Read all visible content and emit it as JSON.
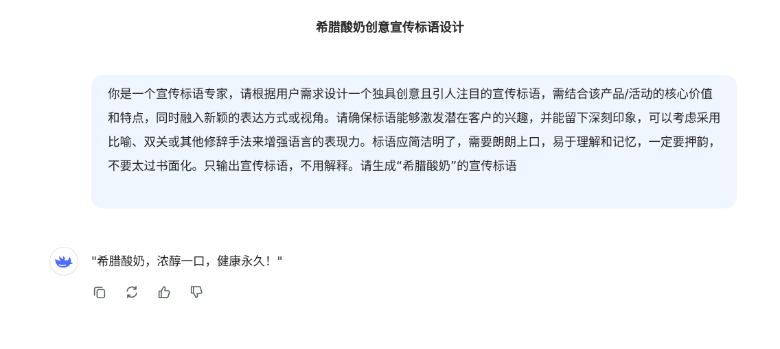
{
  "conversation": {
    "title": "希腊酸奶创意宣传标语设计"
  },
  "user_message": {
    "text": "你是一个宣传标语专家，请根据用户需求设计一个独具创意且引人注目的宣传标语，需结合该产品/活动的核心价值和特点，同时融入新颖的表达方式或视角。请确保标语能够激发潜在客户的兴趣，并能留下深刻印象，可以考虑采用比喻、双关或其他修辞手法来增强语言的表现力。标语应简洁明了，需要朗朗上口，易于理解和记忆，一定要押韵，不要太过书面化。只输出宣传标语，不用解释。请生成“希腊酸奶”的宣传标语"
  },
  "assistant_message": {
    "avatar_icon": "whale-logo-icon",
    "text": "\"希腊酸奶，浓醇一口，健康永久！\""
  },
  "actions": [
    {
      "icon": "copy-icon"
    },
    {
      "icon": "regenerate-icon"
    },
    {
      "icon": "thumbs-up-icon"
    },
    {
      "icon": "thumbs-down-icon"
    }
  ],
  "colors": {
    "user_bubble_bg": "#eff6ff",
    "brand_blue": "#4d6bfe",
    "icon_gray": "#555a63"
  }
}
